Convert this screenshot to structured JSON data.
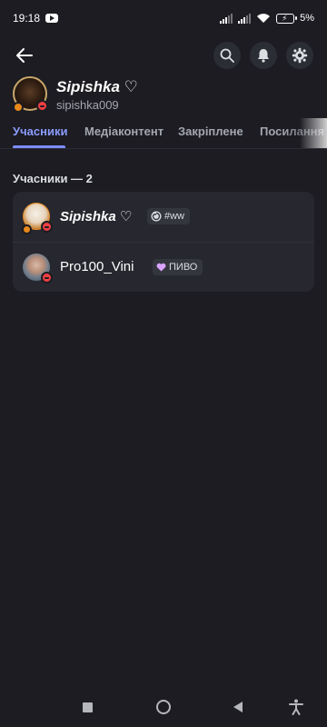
{
  "status_bar": {
    "time": "19:18",
    "battery": "5"
  },
  "header": {
    "back_icon": "arrow-left-icon",
    "actions": [
      {
        "icon": "search-icon"
      },
      {
        "icon": "bell-icon"
      },
      {
        "icon": "gear-icon"
      }
    ]
  },
  "profile": {
    "display_name": "Sipishka ♡",
    "username": "sipishka009"
  },
  "tabs": [
    {
      "label": "Учасники",
      "active": true
    },
    {
      "label": "Медіаконтент",
      "active": false
    },
    {
      "label": "Закріплене",
      "active": false
    },
    {
      "label": "Посилання",
      "active": false
    }
  ],
  "members": {
    "section_title": "Учасники — 2",
    "items": [
      {
        "name": "Sipishka ♡",
        "tag": "#ww",
        "tag_icon": "spiral-icon",
        "status": "dnd"
      },
      {
        "name": "Pro100_Vini",
        "tag": "ПИВО",
        "tag_icon": "heart-icon",
        "status": "dnd"
      }
    ]
  },
  "nav_bar": {
    "buttons": [
      "recents-square-icon",
      "home-circle-icon",
      "back-triangle-icon",
      "accessibility-icon"
    ]
  },
  "colors": {
    "background": "#1c1c22",
    "accent": "#8a9cff",
    "dnd": "#f23f43",
    "card": "#27282f"
  }
}
